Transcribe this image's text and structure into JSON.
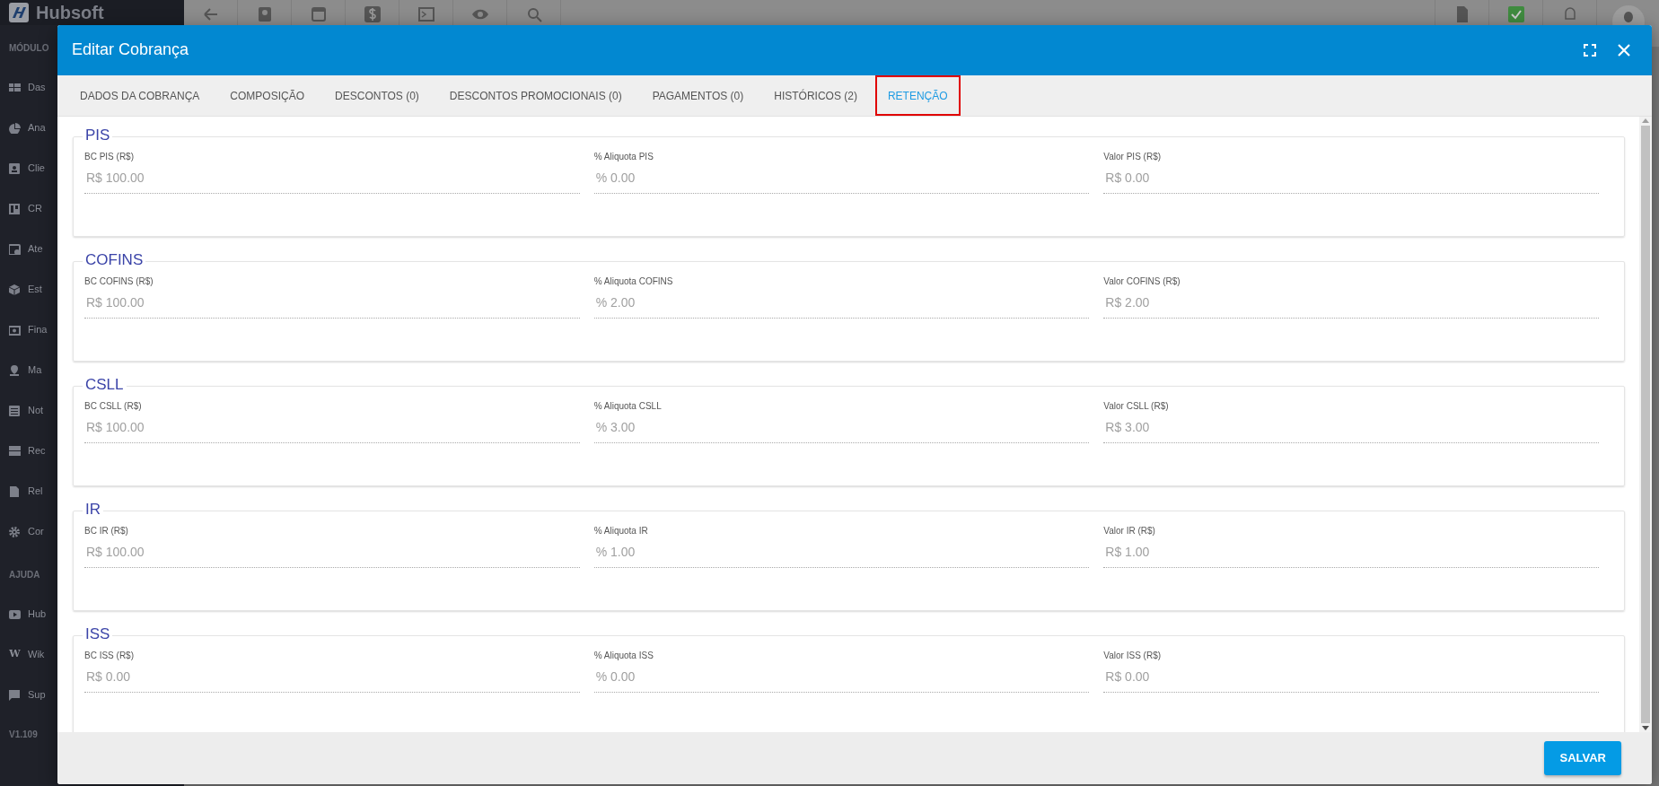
{
  "app": {
    "logo_text": "Hubsoft",
    "version": "V1.109"
  },
  "sidebar": {
    "sections": [
      {
        "title": "MÓDULO",
        "items": [
          {
            "label": "Das"
          },
          {
            "label": "Ana"
          },
          {
            "label": "Clie"
          },
          {
            "label": "CR"
          },
          {
            "label": "Ate"
          },
          {
            "label": "Est"
          },
          {
            "label": "Fina"
          },
          {
            "label": "Ma"
          },
          {
            "label": "Not"
          },
          {
            "label": "Rec"
          },
          {
            "label": "Rel"
          },
          {
            "label": "Cor"
          }
        ]
      },
      {
        "title": "AJUDA",
        "items": [
          {
            "label": "Hub"
          },
          {
            "label": "Wik",
            "icon_text": "W"
          },
          {
            "label": "Sup"
          }
        ]
      }
    ]
  },
  "modal": {
    "title": "Editar Cobrança",
    "tabs": [
      {
        "label": "DADOS DA COBRANÇA",
        "selected": false,
        "highlighted": false
      },
      {
        "label": "COMPOSIÇÃO",
        "selected": false,
        "highlighted": false
      },
      {
        "label": "DESCONTOS (0)",
        "selected": false,
        "highlighted": false
      },
      {
        "label": "DESCONTOS PROMOCIONAIS (0)",
        "selected": false,
        "highlighted": false
      },
      {
        "label": "PAGAMENTOS (0)",
        "selected": false,
        "highlighted": false
      },
      {
        "label": "HISTÓRICOS (2)",
        "selected": false,
        "highlighted": false
      },
      {
        "label": "RETENÇÃO",
        "selected": true,
        "highlighted": true
      }
    ],
    "sections": [
      {
        "title": "PIS",
        "fields": [
          {
            "label": "BC PIS (R$)",
            "value": "R$ 100.00",
            "disabled": true
          },
          {
            "label": "% Aliquota PIS",
            "value": "% 0.00",
            "disabled": true
          },
          {
            "label": "Valor PIS (R$)",
            "value": "R$ 0.00",
            "disabled": true
          }
        ]
      },
      {
        "title": "COFINS",
        "fields": [
          {
            "label": "BC COFINS (R$)",
            "value": "R$ 100.00",
            "disabled": true
          },
          {
            "label": "% Aliquota COFINS",
            "value": "% 2.00",
            "disabled": true
          },
          {
            "label": "Valor COFINS (R$)",
            "value": "R$ 2.00",
            "disabled": true
          }
        ]
      },
      {
        "title": "CSLL",
        "fields": [
          {
            "label": "BC CSLL (R$)",
            "value": "R$ 100.00",
            "disabled": true
          },
          {
            "label": "% Aliquota CSLL",
            "value": "% 3.00",
            "disabled": true
          },
          {
            "label": "Valor CSLL (R$)",
            "value": "R$ 3.00",
            "disabled": true
          }
        ]
      },
      {
        "title": "IR",
        "fields": [
          {
            "label": "BC IR (R$)",
            "value": "R$ 100.00",
            "disabled": true
          },
          {
            "label": "% Aliquota IR",
            "value": "% 1.00",
            "disabled": true
          },
          {
            "label": "Valor IR (R$)",
            "value": "R$ 1.00",
            "disabled": true
          }
        ]
      },
      {
        "title": "ISS",
        "fields": [
          {
            "label": "BC ISS (R$)",
            "value": "R$ 0.00",
            "disabled": true
          },
          {
            "label": "% Aliquota ISS",
            "value": "% 0.00",
            "disabled": true
          },
          {
            "label": "Valor ISS (R$)",
            "value": "R$ 0.00",
            "disabled": true
          }
        ]
      }
    ],
    "save_button": "SALVAR"
  }
}
